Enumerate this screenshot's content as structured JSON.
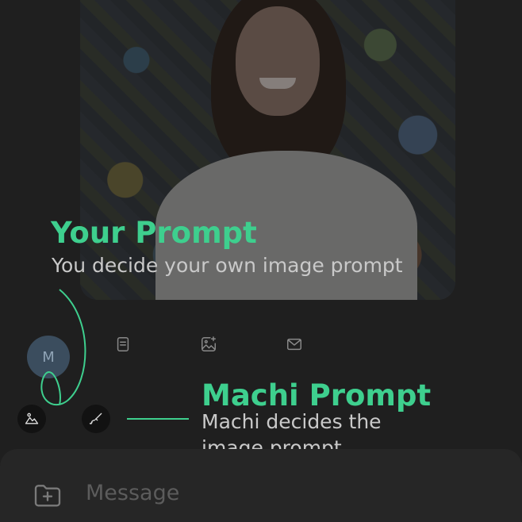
{
  "chat": {
    "avatar_initial": "M"
  },
  "annotations": {
    "your_prompt": {
      "title": "Your Prompt",
      "description": "You decide your own image prompt"
    },
    "machi_prompt": {
      "title": "Machi Prompt",
      "description_lines": [
        "Machi decides the",
        "image prompt"
      ]
    }
  },
  "icons": {
    "actions": [
      "document-icon",
      "image-sparkle-icon",
      "mail-icon"
    ],
    "mode_buttons": [
      "image-mountain-icon",
      "brush-icon"
    ],
    "composer": "add-folder-icon"
  },
  "composer": {
    "placeholder": "Message"
  },
  "colors": {
    "accent": "#3ecf8e",
    "background": "#1f1f1f",
    "composer_bg": "#262626",
    "avatar_bg": "#3b4d5e"
  }
}
